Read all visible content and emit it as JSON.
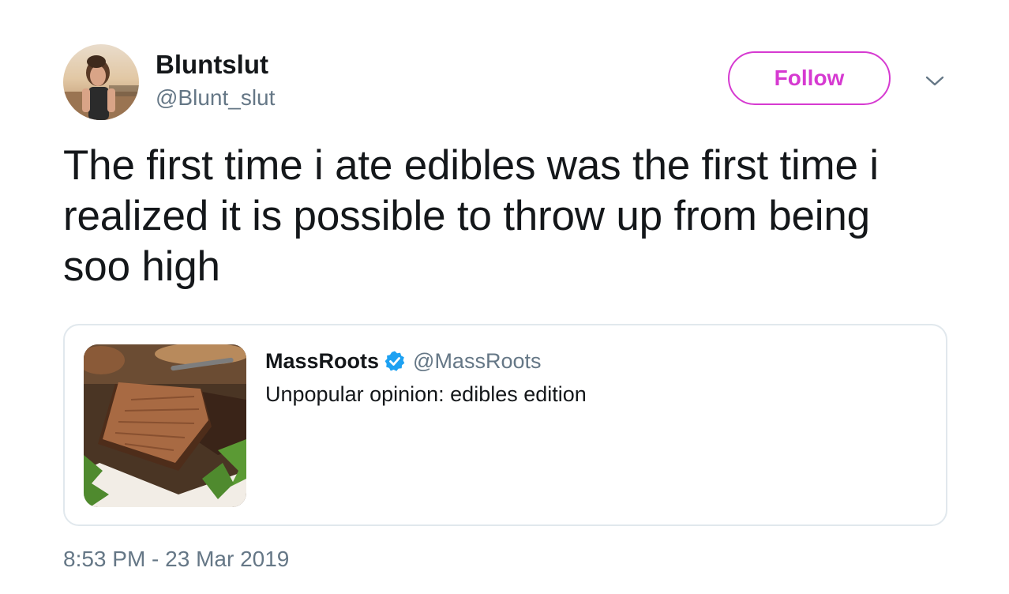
{
  "author": {
    "display_name": "Bluntslut",
    "handle": "@Blunt_slut"
  },
  "follow_label": "Follow",
  "tweet": {
    "text": "The first time i ate edibles was the first time i realized it is possible to throw up from being soo high",
    "timestamp": "8:53 PM - 23 Mar 2019"
  },
  "quoted_tweet": {
    "display_name": "MassRoots",
    "handle": "@MassRoots",
    "verified": true,
    "text": "Unpopular opinion: edibles edition"
  },
  "icons": {
    "dropdown": "chevron-down-icon",
    "verified": "verified-badge-icon"
  },
  "colors": {
    "follow_accent": "#d63ad1",
    "verified_blue": "#1da1f2",
    "secondary_text": "#657786",
    "card_border": "#e1e8ed"
  }
}
